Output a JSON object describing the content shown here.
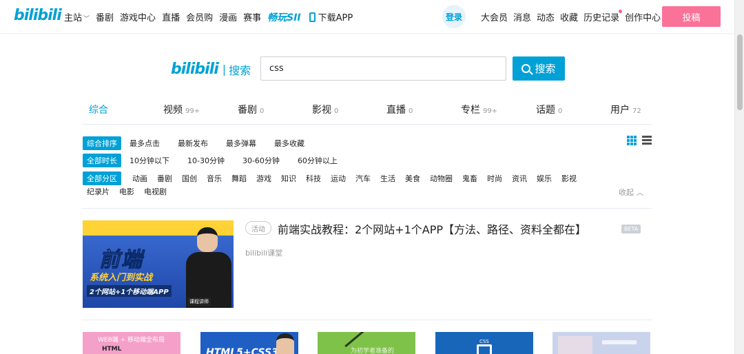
{
  "header": {
    "logo": "bilibili",
    "nav_left": [
      "主站",
      "番剧",
      "游戏中心",
      "直播",
      "会员购",
      "漫画",
      "赛事"
    ],
    "game_logo": "畅玩SII",
    "download": "下载APP",
    "login": "登录",
    "nav_right": [
      "大会员",
      "消息",
      "动态",
      "收藏",
      "历史记录",
      "创作中心"
    ],
    "upload": "投稿",
    "colors": {
      "accent": "#00a1d6",
      "pink": "#fb7299"
    }
  },
  "search": {
    "brand": "bilibili",
    "label": "搜索",
    "query": "css",
    "button": "搜索"
  },
  "tabs": [
    {
      "label": "综合",
      "count": ""
    },
    {
      "label": "视频",
      "count": "99+"
    },
    {
      "label": "番剧",
      "count": "0"
    },
    {
      "label": "影视",
      "count": "0"
    },
    {
      "label": "直播",
      "count": "0"
    },
    {
      "label": "专栏",
      "count": "99+"
    },
    {
      "label": "话题",
      "count": "0"
    },
    {
      "label": "用户",
      "count": "72"
    }
  ],
  "filters": {
    "sort": {
      "active": "综合排序",
      "options": [
        "最多点击",
        "最新发布",
        "最多弹幕",
        "最多收藏"
      ]
    },
    "duration": {
      "active": "全部时长",
      "options": [
        "10分钟以下",
        "10-30分钟",
        "30-60分钟",
        "60分钟以上"
      ]
    },
    "category": {
      "active": "全部分区",
      "options": [
        "动画",
        "番剧",
        "国创",
        "音乐",
        "舞蹈",
        "游戏",
        "知识",
        "科技",
        "运动",
        "汽车",
        "生活",
        "美食",
        "动物圈",
        "鬼畜",
        "时尚",
        "资讯",
        "娱乐",
        "影视"
      ],
      "options2": [
        "纪录片",
        "电影",
        "电视剧"
      ]
    },
    "collapse": "收起"
  },
  "result": {
    "tag": "活动",
    "title": "前端实战教程：2个网站+1个APP【方法、路径、资料全都在】",
    "beta": "BETA",
    "author": "bilibili课堂",
    "thumb": {
      "big": "前端",
      "sub1": "系统入门到实战",
      "sub2": "2个网站+1个移动端APP",
      "badge": "课程讲师"
    }
  },
  "cards": [
    {
      "text": "WEB端 + 移动端全布局",
      "text2": "HTML",
      "bg": "#f5a0c8"
    },
    {
      "text": "HTML5+CSS3",
      "text2": "",
      "bg": "#1f5fc4"
    },
    {
      "text": "为初学者准备的",
      "text2": "",
      "bg": "#7fc24a"
    },
    {
      "text": "CSS",
      "text2": "",
      "bg": "#1766b9"
    },
    {
      "text": "",
      "text2": "",
      "bg": "#c9d3ec"
    }
  ]
}
